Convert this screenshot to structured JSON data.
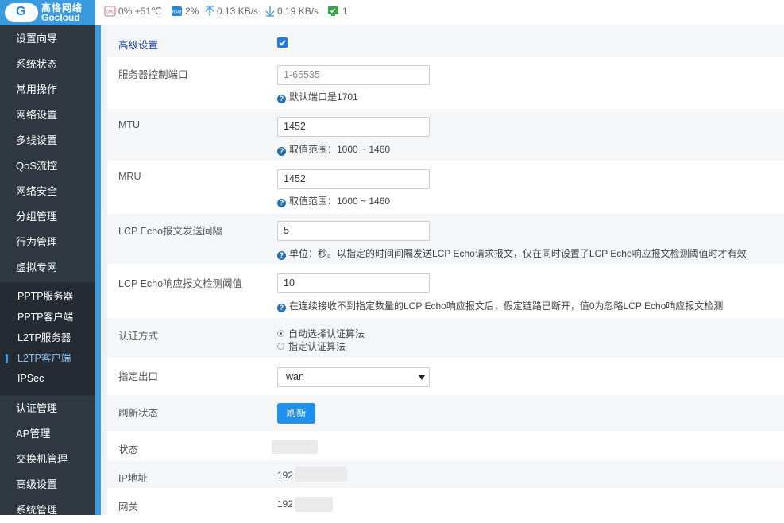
{
  "header": {
    "brand_cn": "高恪网络",
    "brand_en": "Gocloud",
    "cpu_icon": "CPU",
    "cpu": "0% +51℃",
    "ram_icon": "RAM",
    "ram": "2%",
    "upload": "0.13 KB/s",
    "download": "0.19 KB/s",
    "devices": "1"
  },
  "sidebar": {
    "items": [
      "设置向导",
      "系统状态",
      "常用操作",
      "网络设置",
      "多线设置",
      "QoS流控",
      "网络安全",
      "分组管理",
      "行为管理",
      "虚拟专网"
    ],
    "sub_items": [
      "PPTP服务器",
      "PPTP客户端",
      "L2TP服务器",
      "L2TP客户端",
      "IPSec"
    ],
    "items_after": [
      "认证管理",
      "AP管理",
      "交换机管理",
      "高级设置",
      "系统管理"
    ]
  },
  "form": {
    "advanced_label": "高级设置",
    "port_label": "服务器控制端口",
    "port_placeholder": "1-65535",
    "port_hint": "默认端口是1701",
    "mtu_label": "MTU",
    "mtu_value": "1452",
    "mtu_hint": "取值范围：1000 ~ 1460",
    "mru_label": "MRU",
    "mru_value": "1452",
    "mru_hint": "取值范围：1000 ~ 1460",
    "lcp_interval_label": "LCP Echo报文发送间隔",
    "lcp_interval_value": "5",
    "lcp_interval_hint": "单位：秒。以指定的时间间隔发送LCP Echo请求报文，仅在同时设置了LCP Echo响应报文检测阈值时才有效",
    "lcp_threshold_label": "LCP Echo响应报文检测阈值",
    "lcp_threshold_value": "10",
    "lcp_threshold_hint": "在连续接收不到指定数量的LCP Echo响应报文后，假定链路已断开，值0为忽略LCP Echo响应报文检测",
    "auth_label": "认证方式",
    "auth_opt1": "自动选择认证算法",
    "auth_opt2": "指定认证算法",
    "iface_label": "指定出口",
    "iface_value": "wan",
    "refresh_label": "刷新状态",
    "refresh_button": "刷新",
    "status_label": "状态",
    "ip_label": "IP地址",
    "ip_value": "192",
    "gw_label": "网关",
    "gw_value": "192"
  },
  "colors": {
    "accent": "#3a9be0",
    "sidebar": "#2f3740",
    "button": "#1e90f0"
  }
}
